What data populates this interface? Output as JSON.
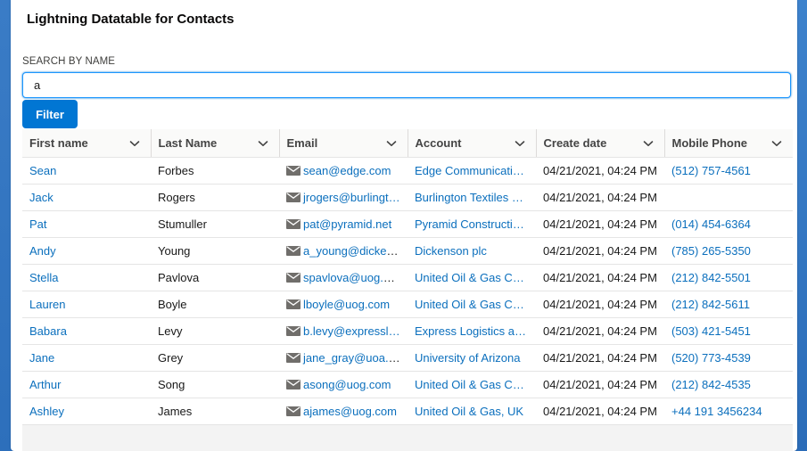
{
  "card": {
    "title": "Lightning Datatable for Contacts"
  },
  "search": {
    "label": "SEARCH BY NAME",
    "value": "a"
  },
  "filter_button": "Filter",
  "columns": [
    "First name",
    "Last Name",
    "Email",
    "Account",
    "Create date",
    "Mobile Phone"
  ],
  "rows": [
    {
      "first": "Sean",
      "last": "Forbes",
      "email": "sean@edge.com",
      "account": "Edge Communicatio…",
      "created": "04/21/2021, 04:24 PM",
      "phone": "(512) 757-4561"
    },
    {
      "first": "Jack",
      "last": "Rogers",
      "email": "jrogers@burlingt…",
      "account": "Burlington Textiles C…",
      "created": "04/21/2021, 04:24 PM",
      "phone": ""
    },
    {
      "first": "Pat",
      "last": "Stumuller",
      "email": "pat@pyramid.net",
      "account": "Pyramid Constructio…",
      "created": "04/21/2021, 04:24 PM",
      "phone": "(014) 454-6364"
    },
    {
      "first": "Andy",
      "last": "Young",
      "email": "a_young@dicken…",
      "account": "Dickenson plc",
      "created": "04/21/2021, 04:24 PM",
      "phone": "(785) 265-5350"
    },
    {
      "first": "Stella",
      "last": "Pavlova",
      "email": "spavlova@uog.c…",
      "account": "United Oil & Gas Co…",
      "created": "04/21/2021, 04:24 PM",
      "phone": "(212) 842-5501"
    },
    {
      "first": "Lauren",
      "last": "Boyle",
      "email": "lboyle@uog.com",
      "account": "United Oil & Gas Co…",
      "created": "04/21/2021, 04:24 PM",
      "phone": "(212) 842-5611"
    },
    {
      "first": "Babara",
      "last": "Levy",
      "email": "b.levy@expressl…",
      "account": "Express Logistics an…",
      "created": "04/21/2021, 04:24 PM",
      "phone": "(503) 421-5451"
    },
    {
      "first": "Jane",
      "last": "Grey",
      "email": "jane_gray@uoa.e…",
      "account": "University of Arizona",
      "created": "04/21/2021, 04:24 PM",
      "phone": "(520) 773-4539"
    },
    {
      "first": "Arthur",
      "last": "Song",
      "email": "asong@uog.com",
      "account": "United Oil & Gas Co…",
      "created": "04/21/2021, 04:24 PM",
      "phone": "(212) 842-4535"
    },
    {
      "first": "Ashley",
      "last": "James",
      "email": "ajames@uog.com",
      "account": "United Oil & Gas, UK",
      "created": "04/21/2021, 04:24 PM",
      "phone": "+44 191 3456234"
    }
  ],
  "colors": {
    "brand": "#0176d3",
    "link": "#0b6fbd",
    "background": "#2a6db7"
  },
  "icons": {
    "column_menu": "chevron-down-icon",
    "email": "envelope-icon"
  }
}
